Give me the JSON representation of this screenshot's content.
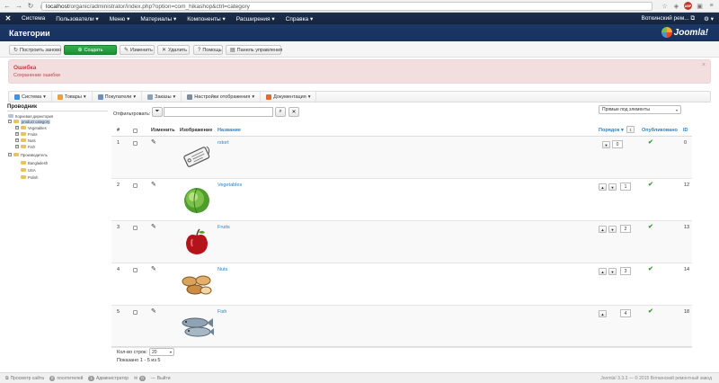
{
  "browser": {
    "url_host": "localhost",
    "url_path": "/organic/administrator/index.php?option=com_hikashop&ctrl=category"
  },
  "admin_menu": {
    "items": [
      "Система",
      "Пользователи",
      "Меню",
      "Материалы",
      "Компоненты",
      "Расширения",
      "Справка"
    ],
    "site_name": "Воткинский рем...",
    "settings_icon": "gear-icon"
  },
  "header": {
    "title": "Категории",
    "brand": "Joomla!"
  },
  "toolbar": {
    "rebuild": "Построить заново",
    "create": "Создать",
    "edit": "Изменить",
    "delete": "Удалить",
    "help": "Помощь",
    "control_panel": "Панель управления"
  },
  "alert": {
    "title": "Ошибка",
    "message": "Сохранение ошибки",
    "close": "×"
  },
  "submenu": {
    "items": [
      "Система",
      "Товары",
      "Покупатели",
      "Заказы",
      "Настройки отображения",
      "Документация"
    ]
  },
  "explorer": {
    "title": "Проводник",
    "nodes": [
      {
        "label": "Корневая директория",
        "level": 0,
        "toggle": ""
      },
      {
        "label": "product category",
        "level": 1,
        "toggle": "−",
        "selected": true
      },
      {
        "label": "Vegetables",
        "level": 2,
        "toggle": "+"
      },
      {
        "label": "Fruits",
        "level": 2,
        "toggle": "+"
      },
      {
        "label": "Nuts",
        "level": 2,
        "toggle": "+"
      },
      {
        "label": "Fish",
        "level": 2,
        "toggle": "+"
      },
      {
        "label": "Производитель",
        "level": 1,
        "toggle": "−"
      },
      {
        "label": "Bangladesh",
        "level": 2,
        "toggle": ""
      },
      {
        "label": "USA",
        "level": 2,
        "toggle": ""
      },
      {
        "label": "Polish",
        "level": 2,
        "toggle": ""
      }
    ]
  },
  "filter": {
    "label": "Отфильтровать:",
    "value": "",
    "display_select": "Прямые под элементы"
  },
  "table": {
    "headers": {
      "num": "#",
      "edit": "Изменить",
      "image": "Изображение",
      "name": "Название",
      "order": "Порядок",
      "published": "Опубликовано",
      "id": "ID"
    },
    "rows": [
      {
        "num": "1",
        "name": "rstort",
        "order": "0",
        "id": "0",
        "image": "tag"
      },
      {
        "num": "2",
        "name": "Vegetables",
        "order": "1",
        "id": "12",
        "image": "cabbage"
      },
      {
        "num": "3",
        "name": "Fruits",
        "order": "2",
        "id": "13",
        "image": "apple"
      },
      {
        "num": "4",
        "name": "Nuts",
        "order": "3",
        "id": "14",
        "image": "nuts"
      },
      {
        "num": "5",
        "name": "Fish",
        "order": "4",
        "id": "18",
        "image": "fish"
      }
    ]
  },
  "pagination": {
    "rows_label": "Кол-во строк:",
    "rows_value": "20",
    "shown": "Показано 1 - 5 из 5"
  },
  "statusbar": {
    "view_site": "Просмотр сайта",
    "visitors_count": "0",
    "visitors": "посетителей",
    "admins_count": "1",
    "admins": "Администратор",
    "messages_count": "0",
    "logout": "Выйти",
    "copyright": "Joomla! 3.3.3 — © 2015 Воткинский ремонтный завод"
  },
  "colors": {
    "menu_bg": "#1b2e4e",
    "header_bg": "#1a3867",
    "create_button": "#2db24b",
    "error_bg": "#f2dede",
    "error_text": "#b94a48",
    "link": "#2a83c6",
    "published": "#3c9a38"
  }
}
